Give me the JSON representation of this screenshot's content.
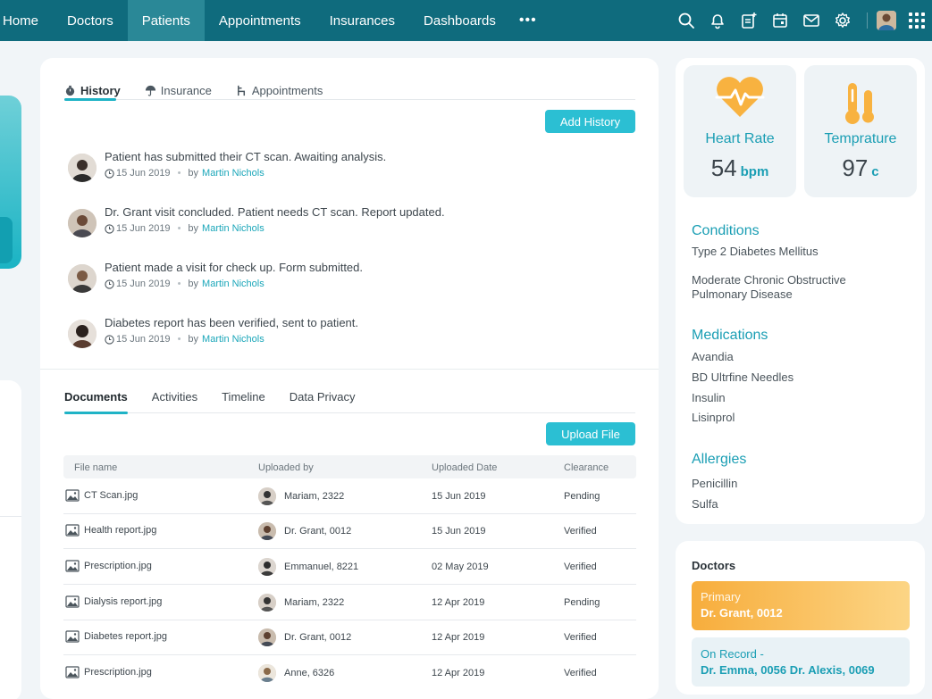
{
  "nav": {
    "items": [
      {
        "label": "Home"
      },
      {
        "label": "Doctors"
      },
      {
        "label": "Patients"
      },
      {
        "label": "Appointments"
      },
      {
        "label": "Insurances"
      },
      {
        "label": "Dashboards"
      }
    ],
    "active": "Patients",
    "more_label": "•••"
  },
  "history_tabs": [
    {
      "label": "History",
      "icon": "stopwatch-icon"
    },
    {
      "label": "Insurance",
      "icon": "umbrella-icon"
    },
    {
      "label": "Appointments",
      "icon": "chair-icon"
    }
  ],
  "add_history_label": "Add History",
  "history": [
    {
      "text": "Patient has submitted their CT scan. Awaiting analysis.",
      "date": "15 Jun 2019",
      "by": "by",
      "author": "Martin Nichols"
    },
    {
      "text": "Dr. Grant visit concluded. Patient needs CT scan. Report updated.",
      "date": "15 Jun 2019",
      "by": "by",
      "author": "Martin Nichols"
    },
    {
      "text": "Patient made a visit for check up. Form submitted.",
      "date": "15 Jun 2019",
      "by": "by",
      "author": "Martin Nichols"
    },
    {
      "text": "Diabetes report has been verified, sent to patient.",
      "date": "15 Jun 2019",
      "by": "by",
      "author": "Martin Nichols"
    }
  ],
  "doc_tabs": [
    "Documents",
    "Activities",
    "Timeline",
    "Data Privacy"
  ],
  "upload_label": "Upload  File",
  "table": {
    "headers": [
      "File name",
      "Uploaded by",
      "Uploaded Date",
      "Clearance"
    ],
    "rows": [
      {
        "file": "CT Scan.jpg",
        "by": "Mariam, 2322",
        "date": "15 Jun 2019",
        "clearance": "Pending"
      },
      {
        "file": "Health report.jpg",
        "by": "Dr. Grant, 0012",
        "date": "15 Jun 2019",
        "clearance": "Verified"
      },
      {
        "file": "Prescription.jpg",
        "by": "Emmanuel, 8221",
        "date": "02 May 2019",
        "clearance": "Verified"
      },
      {
        "file": "Dialysis report.jpg",
        "by": "Mariam, 2322",
        "date": "12 Apr 2019",
        "clearance": "Pending"
      },
      {
        "file": "Diabetes report.jpg",
        "by": "Dr. Grant, 0012",
        "date": "12 Apr 2019",
        "clearance": "Verified"
      },
      {
        "file": "Prescription.jpg",
        "by": "Anne, 6326",
        "date": "12 Apr 2019",
        "clearance": "Verified"
      }
    ]
  },
  "vitals": {
    "heart": {
      "label": "Heart Rate",
      "value": "54",
      "unit": "bpm"
    },
    "temp": {
      "label": "Temprature",
      "value": "97",
      "unit": "c"
    }
  },
  "conditions": {
    "title": "Conditions",
    "items": [
      "Type 2 Diabetes Mellitus",
      "Moderate Chronic Obstructive Pulmonary Disease"
    ]
  },
  "medications": {
    "title": "Medications",
    "items": [
      "Avandia",
      "BD Ultrfine Needles",
      "Insulin",
      "Lisinprol"
    ]
  },
  "allergies": {
    "title": "Allergies",
    "items": [
      "Penicillin",
      "Sulfa"
    ]
  },
  "doctors": {
    "title": "Doctors",
    "primary_label": "Primary",
    "primary_name": "Dr. Grant, 0012",
    "record_label": "On Record -",
    "record_names": "Dr. Emma, 0056 Dr. Alexis, 0069"
  },
  "colors": {
    "nav": "#0f6b7d",
    "accent": "#1a9eb4",
    "button": "#2bbfd3",
    "primary_card": "#f7ad3c"
  }
}
